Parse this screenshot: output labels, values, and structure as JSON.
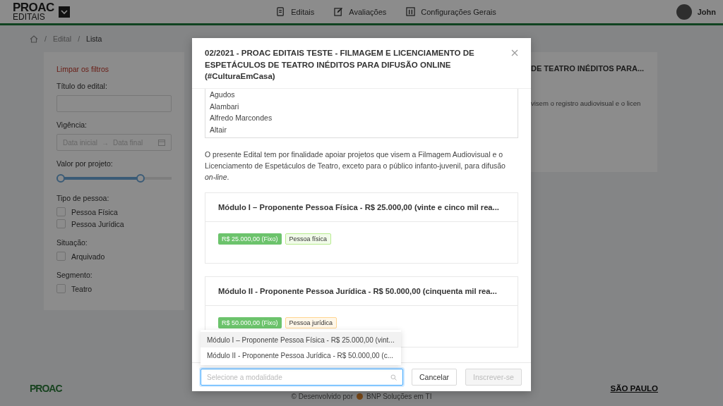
{
  "header": {
    "logo": {
      "title": "PROAC",
      "subtitle": "EDITAIS"
    },
    "nav": [
      {
        "label": "Editais"
      },
      {
        "label": "Avaliações"
      },
      {
        "label": "Configurações Gerais"
      }
    ],
    "user": {
      "name": "John"
    }
  },
  "breadcrumb": [
    {
      "separator": "/",
      "label": "Edital"
    },
    {
      "separator": "/",
      "label": "Lista"
    }
  ],
  "filters": {
    "clear_link": "Limpar os filtros",
    "title_field": {
      "label": "Título do edital:"
    },
    "date_range": {
      "label": "Vigência:",
      "start_placeholder": "Data inicial",
      "separator": "→",
      "end_placeholder": "Data final"
    },
    "slider": {
      "label": "Valor por projeto:",
      "level": 0.75
    },
    "groups": [
      {
        "label": "Tipo de pessoa:",
        "options": [
          {
            "label": "Pessoa Física",
            "checked": false
          },
          {
            "label": "Pessoa Jurídica",
            "checked": false
          }
        ]
      },
      {
        "label": "Situação:",
        "options": [
          {
            "label": "Arquivado",
            "checked": false
          }
        ]
      },
      {
        "label": "Segmento:",
        "options": [
          {
            "label": "Teatro",
            "checked": false
          }
        ]
      }
    ]
  },
  "background_card": {
    "title": "DE TEATRO INÉDITOS PARA...",
    "text": "visem o registro audiovisual e o licen"
  },
  "modal": {
    "title": "02/2021 - PROAC EDITAIS TESTE - FILMAGEM E LICENCIAMENTO DE ESPETÁCULOS DE TEATRO INÉDITOS PARA DIFUSÃO ONLINE (#CulturaEmCasa)",
    "cities": [
      "Agudos",
      "Alambari",
      "Alfredo Marcondes",
      "Altair"
    ],
    "description": "O presente Edital tem por finalidade apoiar projetos que visem a Filmagem Audiovisual e o Licenciamento de Espetáculos de Teatro, exceto para o público infanto-juvenil, para difusão *on-line*.",
    "modules": [
      {
        "title": "Módulo I – Proponente Pessoa Física - R$ 25.000,00 (vinte e cinco mil rea...",
        "price": "R$ 25.000,00 (Fixo)",
        "tag": "Pessoa física",
        "color": "#b7eb8f"
      },
      {
        "title": "Módulo II - Proponente Pessoa Jurídica - R$ 50.000,00 (cinquenta mil rea...",
        "price": "R$ 50.000,00 (Fixo)",
        "tag": "Pessoa jurídica",
        "color": "#ffd591"
      }
    ],
    "dropdown_options": [
      {
        "label": "Módulo I – Proponente Pessoa Física - R$ 25.000,00 (vint...",
        "selected": true
      },
      {
        "label": "Módulo II - Proponente Pessoa Jurídica - R$ 50.000,00 (c...",
        "selected": false
      }
    ],
    "select": {
      "placeholder": "Selecione a modalidade"
    },
    "buttons": [
      {
        "label": "Cancelar",
        "disabled": false
      },
      {
        "label": "Inscrever-se",
        "disabled": true
      }
    ]
  },
  "footer": {
    "logo": "PROAC",
    "credit": "© Desenvolvido por",
    "company": "BNP Soluções em TI",
    "state_logo": "SÃO PAULO"
  }
}
